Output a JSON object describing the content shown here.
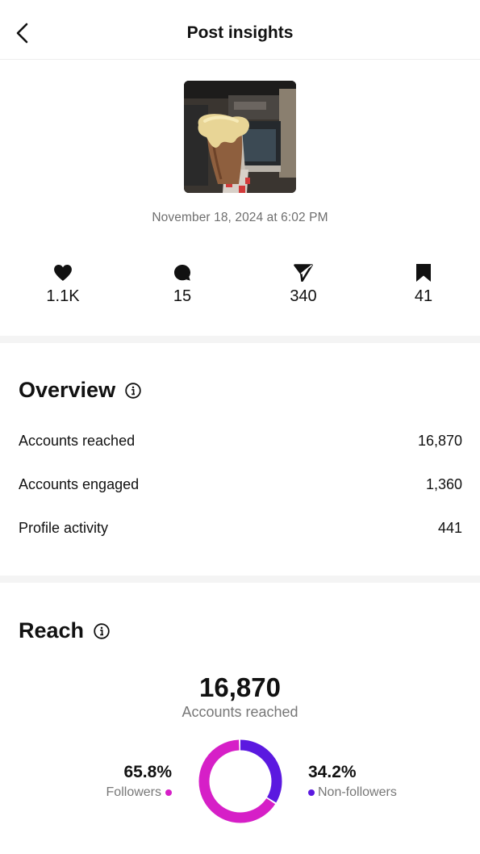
{
  "header": {
    "title": "Post insights"
  },
  "post": {
    "date": "November 18, 2024 at 6:02 PM"
  },
  "interactions": [
    {
      "icon": "heart-icon",
      "value": "1.1K"
    },
    {
      "icon": "comment-icon",
      "value": "15"
    },
    {
      "icon": "share-icon",
      "value": "340"
    },
    {
      "icon": "bookmark-icon",
      "value": "41"
    }
  ],
  "overview": {
    "title": "Overview",
    "rows": [
      {
        "label": "Accounts reached",
        "value": "16,870"
      },
      {
        "label": "Accounts engaged",
        "value": "1,360"
      },
      {
        "label": "Profile activity",
        "value": "441"
      }
    ]
  },
  "reach": {
    "title": "Reach",
    "total": "16,870",
    "total_label": "Accounts reached",
    "followers": {
      "percent": "65.8%",
      "label": "Followers",
      "fraction": 0.658,
      "color": "#d61fc7"
    },
    "non_followers": {
      "percent": "34.2%",
      "label": "Non-followers",
      "fraction": 0.342,
      "color": "#5b19e0"
    }
  }
}
